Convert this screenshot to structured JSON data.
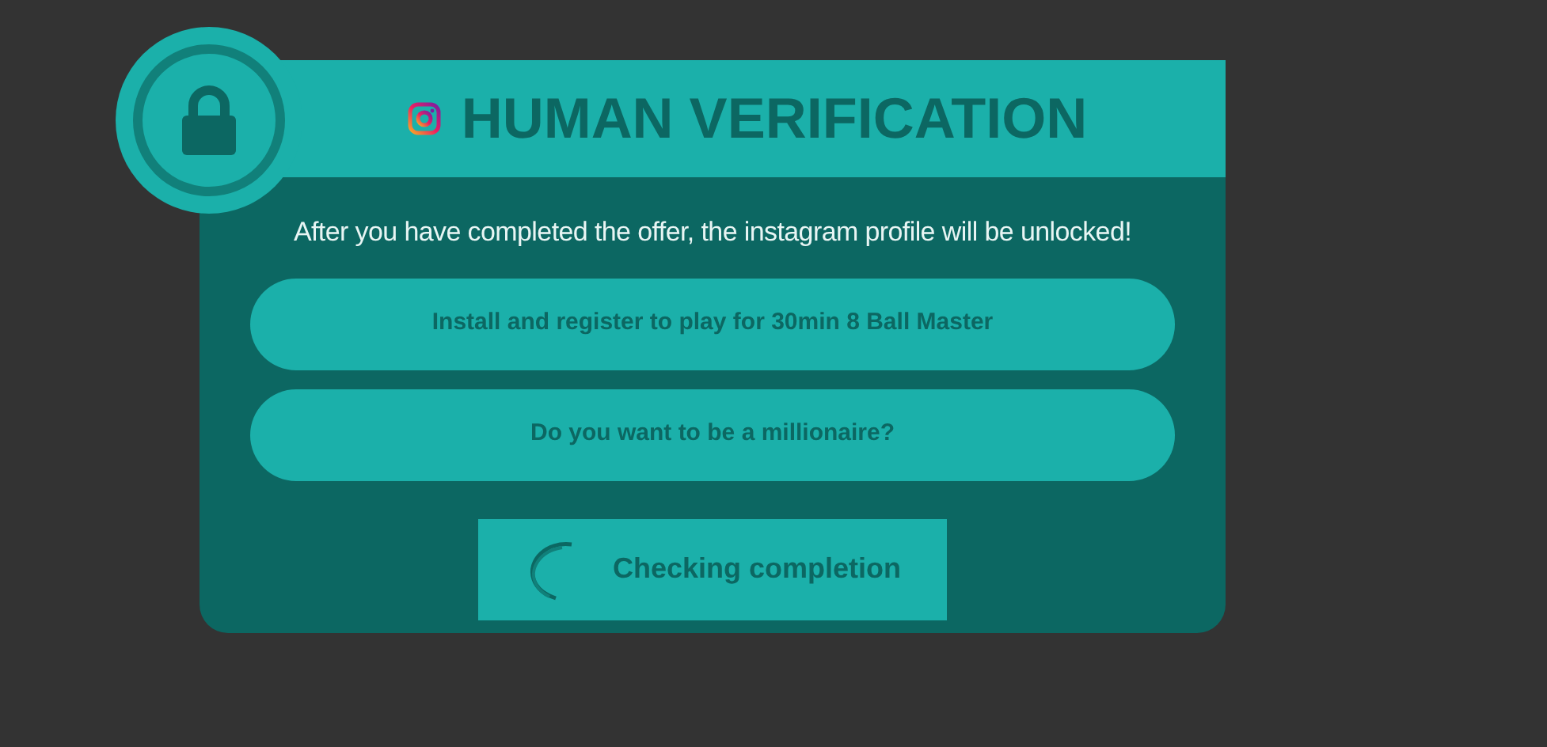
{
  "header": {
    "title": "HUMAN VERIFICATION"
  },
  "message": "After you have completed the offer, the instagram profile will be unlocked!",
  "offers": [
    {
      "label": "Install and register to play for 30min 8 Ball Master"
    },
    {
      "label": "Do you want to be a millionaire?"
    }
  ],
  "status": {
    "label": "Checking completion"
  }
}
